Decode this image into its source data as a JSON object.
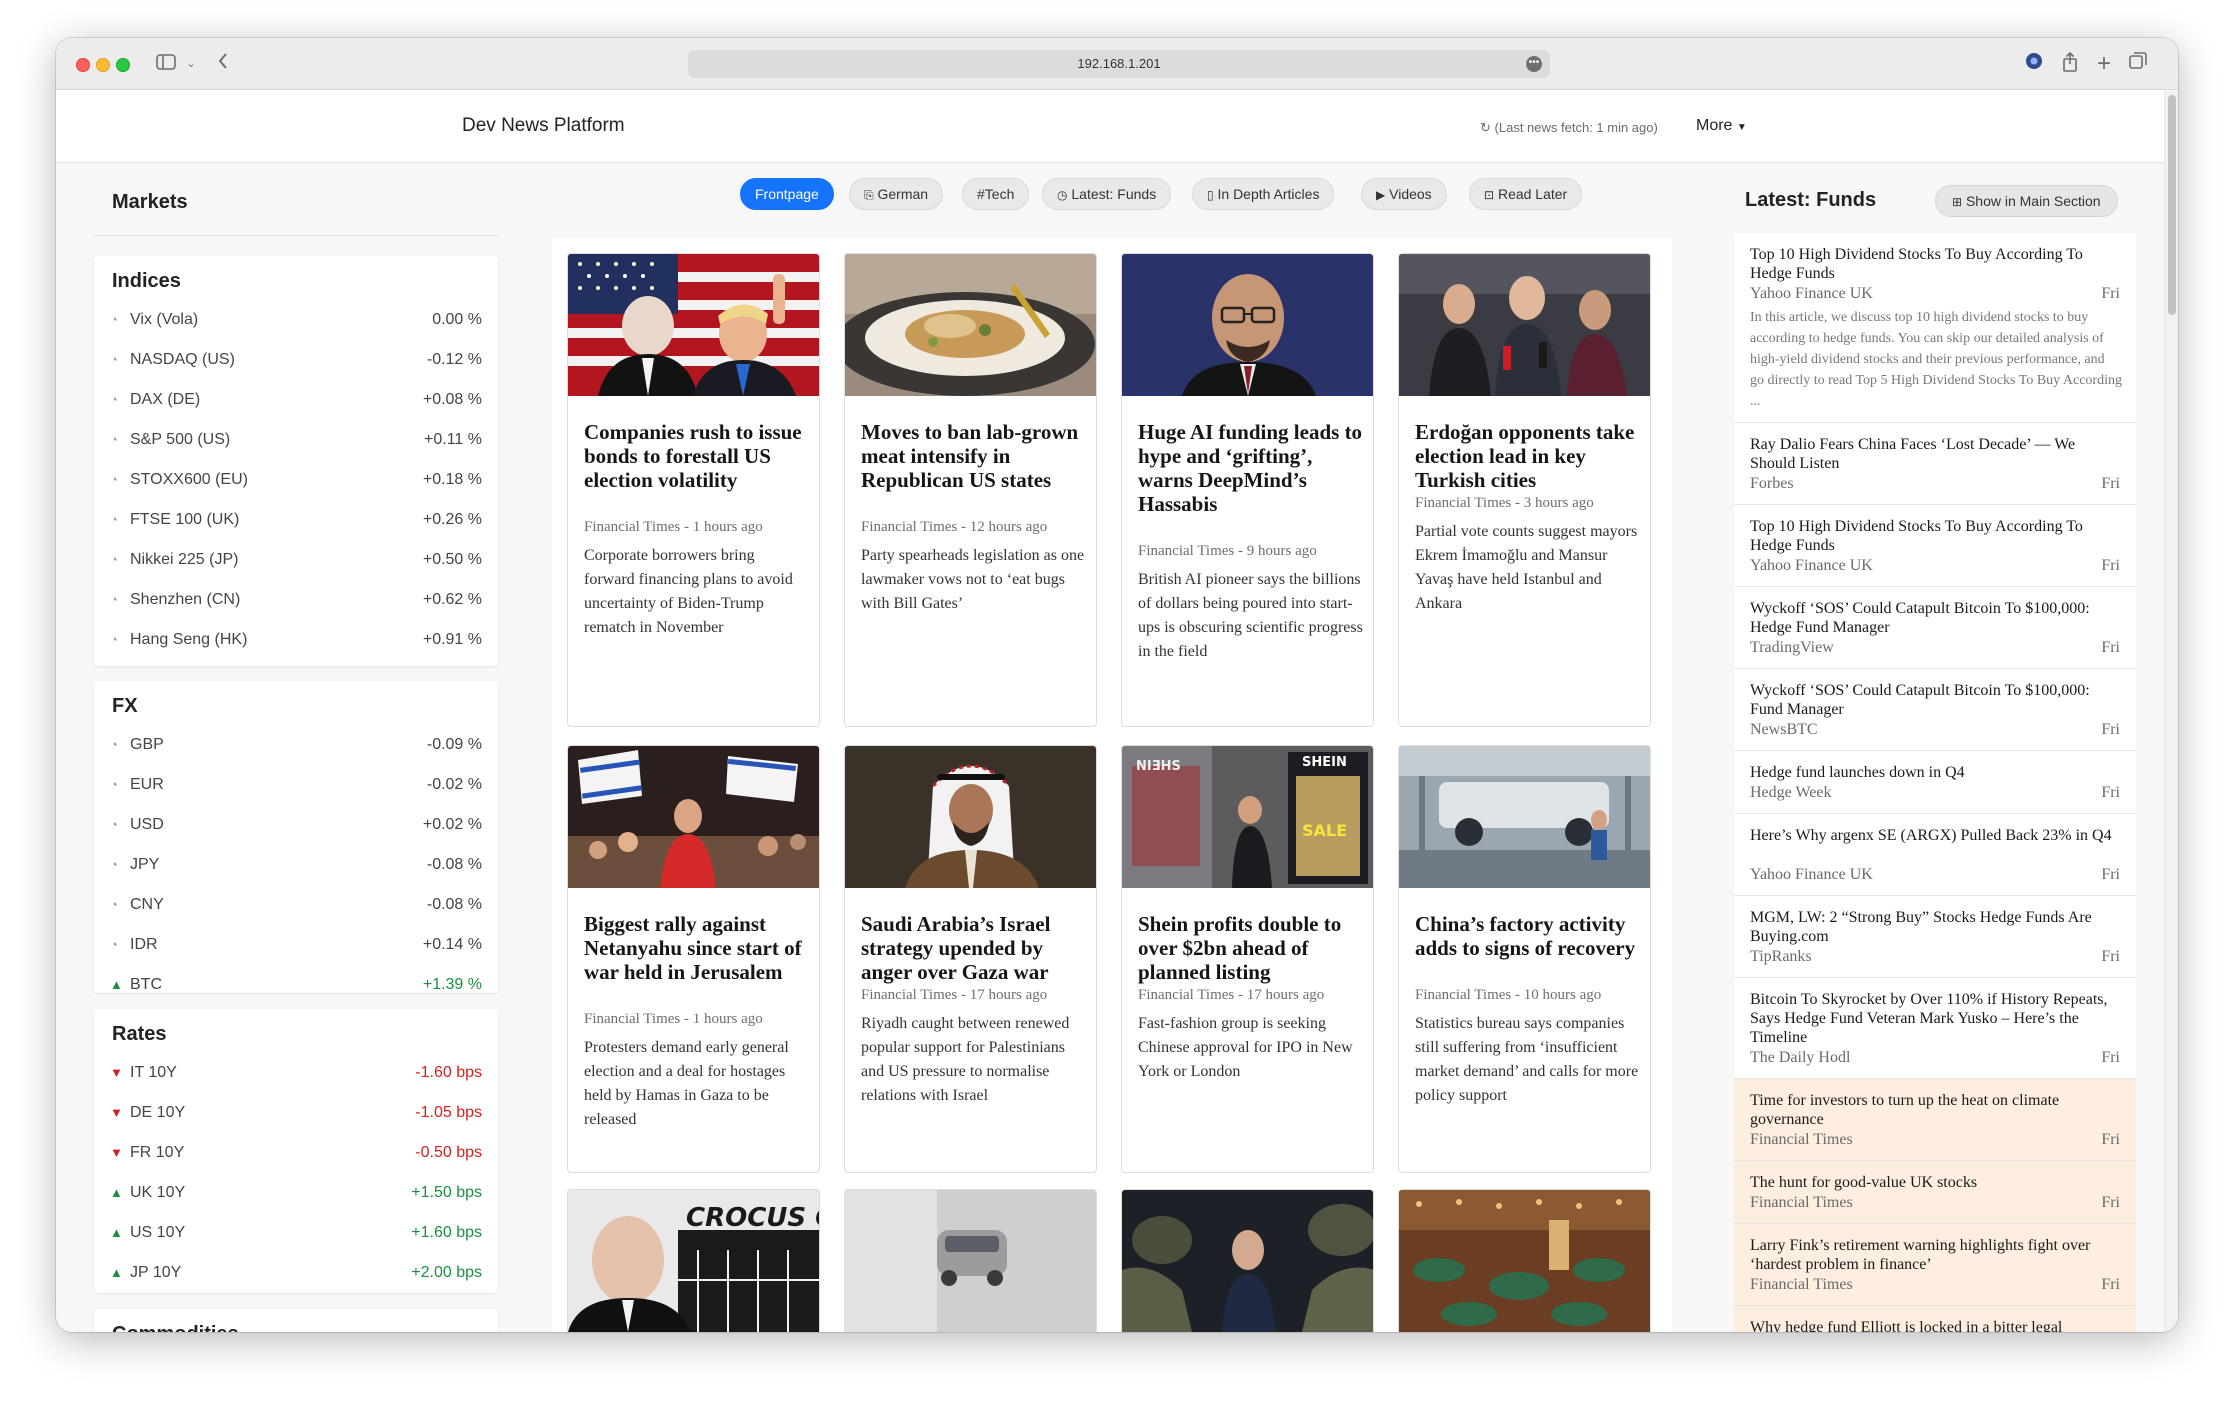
{
  "browser": {
    "url": "192.168.1.201"
  },
  "navbar": {
    "brand": "Dev News Platform",
    "last_fetch": "(Last news fetch: 1 min ago)",
    "more": "More"
  },
  "markets": {
    "title": "Markets",
    "indices": {
      "title": "Indices",
      "rows": [
        {
          "name": "Vix (Vola)",
          "value": "0.00 %",
          "trend": "flat"
        },
        {
          "name": "NASDAQ (US)",
          "value": "-0.12 %",
          "trend": "flat"
        },
        {
          "name": "DAX (DE)",
          "value": "+0.08 %",
          "trend": "flat"
        },
        {
          "name": "S&P 500 (US)",
          "value": "+0.11 %",
          "trend": "flat"
        },
        {
          "name": "STOXX600 (EU)",
          "value": "+0.18 %",
          "trend": "flat"
        },
        {
          "name": "FTSE 100 (UK)",
          "value": "+0.26 %",
          "trend": "flat"
        },
        {
          "name": "Nikkei 225 (JP)",
          "value": "+0.50 %",
          "trend": "flat"
        },
        {
          "name": "Shenzhen (CN)",
          "value": "+0.62 %",
          "trend": "flat"
        },
        {
          "name": "Hang Seng (HK)",
          "value": "+0.91 %",
          "trend": "flat"
        }
      ]
    },
    "fx": {
      "title": "FX",
      "rows": [
        {
          "name": "GBP",
          "value": "-0.09 %",
          "trend": "flat"
        },
        {
          "name": "EUR",
          "value": "-0.02 %",
          "trend": "flat"
        },
        {
          "name": "USD",
          "value": "+0.02 %",
          "trend": "flat"
        },
        {
          "name": "JPY",
          "value": "-0.08 %",
          "trend": "flat"
        },
        {
          "name": "CNY",
          "value": "-0.08 %",
          "trend": "flat"
        },
        {
          "name": "IDR",
          "value": "+0.14 %",
          "trend": "flat"
        },
        {
          "name": "BTC",
          "value": "+1.39 %",
          "trend": "up"
        }
      ]
    },
    "rates": {
      "title": "Rates",
      "rows": [
        {
          "name": "IT 10Y",
          "value": "-1.60 bps",
          "trend": "down"
        },
        {
          "name": "DE 10Y",
          "value": "-1.05 bps",
          "trend": "down"
        },
        {
          "name": "FR 10Y",
          "value": "-0.50 bps",
          "trend": "down"
        },
        {
          "name": "UK 10Y",
          "value": "+1.50 bps",
          "trend": "up"
        },
        {
          "name": "US 10Y",
          "value": "+1.60 bps",
          "trend": "up"
        },
        {
          "name": "JP 10Y",
          "value": "+2.00 bps",
          "trend": "up"
        }
      ]
    },
    "commodities": {
      "title": "Commodities"
    }
  },
  "filters": [
    {
      "label": "Frontpage",
      "icon": "",
      "active": true
    },
    {
      "label": "German",
      "icon": "translate-icon",
      "active": false
    },
    {
      "label": "#Tech",
      "icon": "",
      "active": false
    },
    {
      "label": "Latest: Funds",
      "icon": "clock-icon",
      "active": false
    },
    {
      "label": "In Depth Articles",
      "icon": "book-icon",
      "active": false
    },
    {
      "label": "Videos",
      "icon": "video-icon",
      "active": false
    },
    {
      "label": "Read Later",
      "icon": "bookmark-icon",
      "active": false
    }
  ],
  "articles": [
    {
      "title": "Companies rush to issue bonds to forestall US election volatility",
      "meta": "Financial Times - 1 hours ago",
      "summary": "Corporate borrowers bring forward financing plans to avoid uncertainty of Biden-Trump rematch in November"
    },
    {
      "title": "Moves to ban lab-grown meat intensify in Republican US states",
      "meta": "Financial Times - 12 hours ago",
      "summary": "Party spearheads legislation as one lawmaker vows not to ‘eat bugs with Bill Gates’"
    },
    {
      "title": "Huge AI funding leads to hype and ‘grifting’, warns DeepMind’s Hassabis",
      "meta": "Financial Times - 9 hours ago",
      "summary": "British AI pioneer says the billions of dollars being poured into start-ups is obscuring scientific progress in the field"
    },
    {
      "title": "Erdoğan opponents take election lead in key Turkish cities",
      "meta": "Financial Times - 3 hours ago",
      "summary": "Partial vote counts suggest mayors Ekrem İmamoğlu and Mansur Yavaş have held Istanbul and Ankara"
    },
    {
      "title": "Biggest rally against Netanyahu since start of war held in Jerusalem",
      "meta": "Financial Times - 1 hours ago",
      "summary": "Protesters demand early general election and a deal for hostages held by Hamas in Gaza to be released"
    },
    {
      "title": "Saudi Arabia’s Israel strategy upended by anger over Gaza war",
      "meta": "Financial Times - 17 hours ago",
      "summary": "Riyadh caught between renewed popular support for Palestinians and US pressure to normalise relations with Israel"
    },
    {
      "title": "Shein profits double to over $2bn ahead of planned listing",
      "meta": "Financial Times - 17 hours ago",
      "summary": "Fast-fashion group is seeking Chinese approval for IPO in New York or London"
    },
    {
      "title": "China’s factory activity adds to signs of recovery",
      "meta": "Financial Times - 10 hours ago",
      "summary": "Statistics bureau says companies still suffering from ‘insufficient market demand’ and calls for more policy support"
    }
  ],
  "image_texts": {
    "crocus": "CROCUS CIT",
    "shein": "SHEIN",
    "shein_mirror": "NIƎHS",
    "sale": "SALE"
  },
  "funds": {
    "title": "Latest: Funds",
    "show_button": "Show in Main Section",
    "items": [
      {
        "title": "Top 10 High Dividend Stocks To Buy According To Hedge Funds",
        "source": "Yahoo Finance UK",
        "date": "Fri",
        "excerpt": "In this article, we discuss top 10 high dividend stocks to buy according to hedge funds. You can skip our detailed analysis of high-yield dividend stocks and their previous performance, and go directly to read Top 5 High Dividend Stocks To Buy According ...",
        "highlight": false
      },
      {
        "title": "Ray Dalio Fears China Faces ‘Lost Decade’ — We Should Listen",
        "source": "Forbes",
        "date": "Fri",
        "excerpt": "",
        "highlight": false
      },
      {
        "title": "Top 10 High Dividend Stocks To Buy According To Hedge Funds",
        "source": "Yahoo Finance UK",
        "date": "Fri",
        "excerpt": "",
        "highlight": false
      },
      {
        "title": "Wyckoff ‘SOS’ Could Catapult Bitcoin To $100,000: Hedge Fund Manager",
        "source": "TradingView",
        "date": "Fri",
        "excerpt": "",
        "highlight": false
      },
      {
        "title": "Wyckoff ‘SOS’ Could Catapult Bitcoin To $100,000: Fund Manager",
        "source": "NewsBTC",
        "date": "Fri",
        "excerpt": "",
        "highlight": false
      },
      {
        "title": "Hedge fund launches down in Q4",
        "source": "Hedge Week",
        "date": "Fri",
        "excerpt": "",
        "highlight": false
      },
      {
        "title": "Here’s Why argenx SE (ARGX) Pulled Back 23% in Q4",
        "source": "Yahoo Finance UK",
        "date": "Fri",
        "excerpt": "",
        "highlight": false
      },
      {
        "title": "MGM, LW: 2 “Strong Buy” Stocks Hedge Funds Are Buying.com",
        "source": "TipRanks",
        "date": "Fri",
        "excerpt": "",
        "highlight": false
      },
      {
        "title": "Bitcoin To Skyrocket by Over 110% if History Repeats, Says Hedge Fund Veteran Mark Yusko – Here’s the Timeline",
        "source": "The Daily Hodl",
        "date": "Fri",
        "excerpt": "",
        "highlight": false
      },
      {
        "title": "Time for investors to turn up the heat on climate governance",
        "source": "Financial Times",
        "date": "Fri",
        "excerpt": "",
        "highlight": true
      },
      {
        "title": "The hunt for good-value UK stocks",
        "source": "Financial Times",
        "date": "Fri",
        "excerpt": "",
        "highlight": true
      },
      {
        "title": "Larry Fink’s retirement warning highlights fight over ‘hardest problem in finance’",
        "source": "Financial Times",
        "date": "Fri",
        "excerpt": "",
        "highlight": true
      },
      {
        "title": "Why hedge fund Elliott is locked in a bitter legal",
        "source": "",
        "date": "",
        "excerpt": "",
        "highlight": true
      }
    ]
  },
  "colors": {
    "accent": "#1673fc",
    "up": "#1a8f3c",
    "down": "#d42020",
    "highlight": "#fdeee0"
  }
}
